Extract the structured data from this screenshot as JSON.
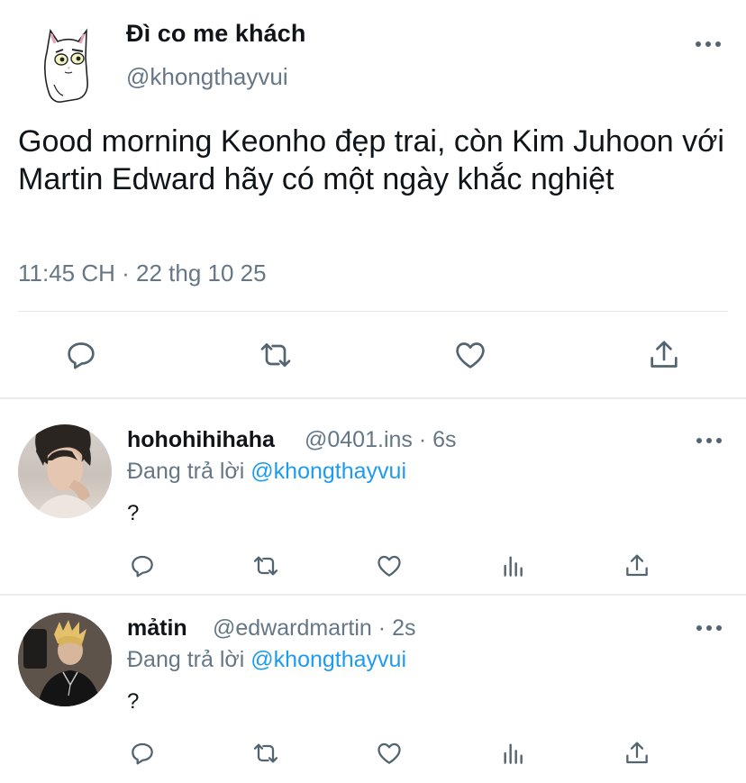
{
  "main_tweet": {
    "display_name": "Đì co me khách",
    "handle": "@khongthayvui",
    "text": "Good morning Keonho đẹp trai, còn Kim Juhoon với Martin Edward hãy có một ngày khắc nghiệt",
    "timestamp": "11:45 CH · 22 thg 10 25",
    "actions": [
      "reply-icon",
      "retweet-icon",
      "like-icon",
      "share-icon"
    ]
  },
  "replies": [
    {
      "display_name": "hohohihihaha",
      "handle": "@0401.ins",
      "time": "· 6s",
      "replying_prefix": "Đang trả lời",
      "replying_to": "@khongthayvui",
      "text": "?"
    },
    {
      "display_name": "mảtin",
      "handle": "@edwardmartin",
      "time": "· 2s",
      "replying_prefix": "Đang trả lời",
      "replying_to": "@khongthayvui",
      "text": "?"
    }
  ],
  "colors": {
    "accent": "#1d9bf0",
    "secondary_text": "#657786",
    "icon": "#536471"
  }
}
